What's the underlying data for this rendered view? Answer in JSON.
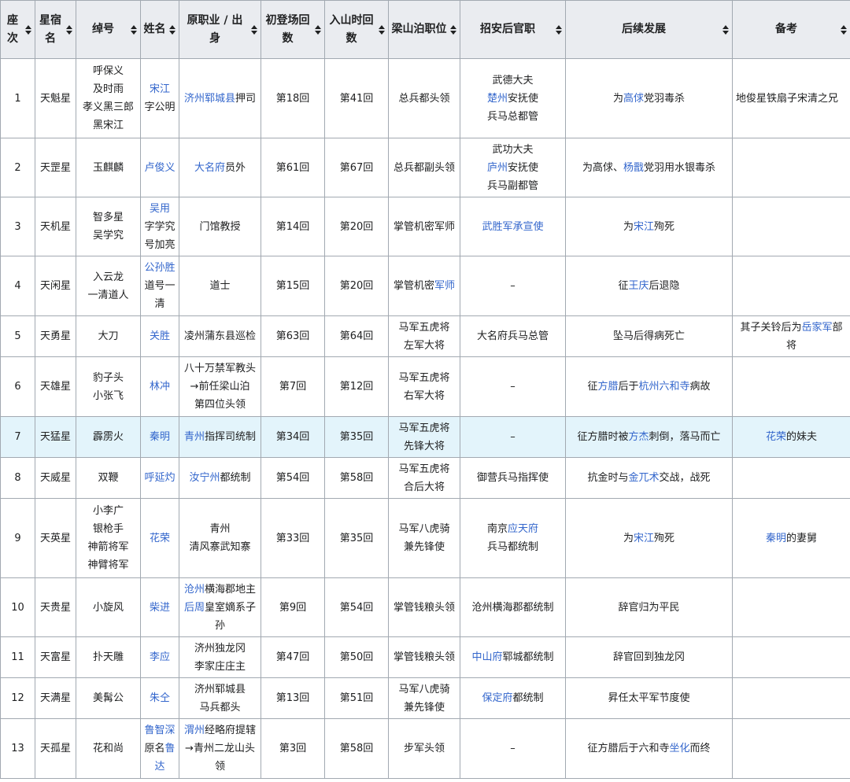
{
  "headers": [
    "座次",
    "星宿名",
    "绰号",
    "姓名",
    "原职业 / 出身",
    "初登场回数",
    "入山时回数",
    "梁山泊职位",
    "招安后官职",
    "后续发展",
    "备考"
  ],
  "rows": [
    {
      "rank": "1",
      "star": "天魁星",
      "nick": [
        [
          {
            "t": "呼保义"
          }
        ],
        [
          {
            "t": "及时雨"
          }
        ],
        [
          {
            "t": "孝义黑三郎"
          }
        ],
        [
          {
            "t": "黑宋江"
          }
        ]
      ],
      "name": [
        [
          {
            "t": "宋江",
            "l": true
          }
        ],
        [
          {
            "t": "字公明"
          }
        ]
      ],
      "origin": [
        [
          {
            "t": "济州",
            "l": true
          },
          {
            "t": "郓城县",
            "l": true
          },
          {
            "t": "押司"
          }
        ]
      ],
      "debut": "第18回",
      "join": "第41回",
      "post": [
        [
          {
            "t": "总兵都头领"
          }
        ]
      ],
      "office": [
        [
          {
            "t": "武德大夫"
          }
        ],
        [
          {
            "t": "楚州",
            "l": true
          },
          {
            "t": "安抚使"
          }
        ],
        [
          {
            "t": "兵马总都管"
          }
        ]
      ],
      "fate": [
        [
          {
            "t": "为"
          },
          {
            "t": "高俅",
            "l": true
          },
          {
            "t": "党羽毒杀"
          }
        ]
      ],
      "note": [
        [
          {
            "t": "地俊星铁扇子宋清之兄"
          }
        ]
      ]
    },
    {
      "rank": "2",
      "star": "天罡星",
      "nick": [
        [
          {
            "t": "玉麒麟"
          }
        ]
      ],
      "name": [
        [
          {
            "t": "卢俊义",
            "l": true
          }
        ]
      ],
      "origin": [
        [
          {
            "t": "大名府",
            "l": true
          },
          {
            "t": "员外"
          }
        ]
      ],
      "debut": "第61回",
      "join": "第67回",
      "post": [
        [
          {
            "t": "总兵都副头领"
          }
        ]
      ],
      "office": [
        [
          {
            "t": "武功大夫"
          }
        ],
        [
          {
            "t": "庐州",
            "l": true
          },
          {
            "t": "安抚使"
          }
        ],
        [
          {
            "t": "兵马副都管"
          }
        ]
      ],
      "fate": [
        [
          {
            "t": "为高俅、"
          },
          {
            "t": "杨戬",
            "l": true
          },
          {
            "t": "党羽用水银毒杀"
          }
        ]
      ],
      "note": []
    },
    {
      "rank": "3",
      "star": "天机星",
      "nick": [
        [
          {
            "t": "智多星"
          }
        ],
        [
          {
            "t": "吴学究"
          }
        ]
      ],
      "name": [
        [
          {
            "t": "吴用",
            "l": true
          }
        ],
        [
          {
            "t": "字学究"
          }
        ],
        [
          {
            "t": "号加亮"
          }
        ]
      ],
      "origin": [
        [
          {
            "t": "门馆教授"
          }
        ]
      ],
      "debut": "第14回",
      "join": "第20回",
      "post": [
        [
          {
            "t": "掌管机密军师"
          }
        ]
      ],
      "office": [
        [
          {
            "t": "武胜军承宣使",
            "l": true
          }
        ]
      ],
      "fate": [
        [
          {
            "t": "为"
          },
          {
            "t": "宋江",
            "l": true
          },
          {
            "t": "殉死"
          }
        ]
      ],
      "note": []
    },
    {
      "rank": "4",
      "star": "天闲星",
      "nick": [
        [
          {
            "t": "入云龙"
          }
        ],
        [
          {
            "t": "一清道人"
          }
        ]
      ],
      "name": [
        [
          {
            "t": "公孙胜",
            "l": true
          }
        ],
        [
          {
            "t": "道号一"
          }
        ],
        [
          {
            "t": "清"
          }
        ]
      ],
      "origin": [
        [
          {
            "t": "道士"
          }
        ]
      ],
      "debut": "第15回",
      "join": "第20回",
      "post": [
        [
          {
            "t": "掌管机密"
          },
          {
            "t": "军师",
            "l": true
          }
        ]
      ],
      "office": [
        [
          {
            "t": "–"
          }
        ]
      ],
      "fate": [
        [
          {
            "t": "征"
          },
          {
            "t": "王庆",
            "l": true
          },
          {
            "t": "后退隐"
          }
        ]
      ],
      "note": []
    },
    {
      "rank": "5",
      "star": "天勇星",
      "nick": [
        [
          {
            "t": "大刀"
          }
        ]
      ],
      "name": [
        [
          {
            "t": "关胜",
            "l": true
          }
        ]
      ],
      "origin": [
        [
          {
            "t": "凌州蒲东县巡检"
          }
        ]
      ],
      "debut": "第63回",
      "join": "第64回",
      "post": [
        [
          {
            "t": "马军五虎将"
          }
        ],
        [
          {
            "t": "左军大将"
          }
        ]
      ],
      "office": [
        [
          {
            "t": "大名府兵马总管"
          }
        ]
      ],
      "fate": [
        [
          {
            "t": "坠马后得病死亡"
          }
        ]
      ],
      "note": [
        [
          {
            "t": "其子关铃后为"
          },
          {
            "t": "岳家军",
            "l": true
          },
          {
            "t": "部"
          }
        ],
        [
          {
            "t": "将"
          }
        ]
      ]
    },
    {
      "rank": "6",
      "star": "天雄星",
      "nick": [
        [
          {
            "t": "豹子头"
          }
        ],
        [
          {
            "t": "小张飞"
          }
        ]
      ],
      "name": [
        [
          {
            "t": "林冲",
            "l": true
          }
        ]
      ],
      "origin": [
        [
          {
            "t": "八十万禁军教头"
          }
        ],
        [
          {
            "t": "→前任梁山泊"
          }
        ],
        [
          {
            "t": "第四位头领"
          }
        ]
      ],
      "debut": "第7回",
      "join": "第12回",
      "post": [
        [
          {
            "t": "马军五虎将"
          }
        ],
        [
          {
            "t": "右军大将"
          }
        ]
      ],
      "office": [
        [
          {
            "t": "–"
          }
        ]
      ],
      "fate": [
        [
          {
            "t": "征"
          },
          {
            "t": "方腊",
            "l": true
          },
          {
            "t": "后于"
          },
          {
            "t": "杭州六和寺",
            "l": true
          },
          {
            "t": "病故"
          }
        ]
      ],
      "note": []
    },
    {
      "rank": "7",
      "star": "天猛星",
      "hl": true,
      "nick": [
        [
          {
            "t": "霹雳火"
          }
        ]
      ],
      "name": [
        [
          {
            "t": "秦明",
            "l": true
          }
        ]
      ],
      "origin": [
        [
          {
            "t": "青州",
            "l": true
          },
          {
            "t": "指挥司统制"
          }
        ]
      ],
      "debut": "第34回",
      "join": "第35回",
      "post": [
        [
          {
            "t": "马军五虎将"
          }
        ],
        [
          {
            "t": "先锋大将"
          }
        ]
      ],
      "office": [
        [
          {
            "t": "–"
          }
        ]
      ],
      "fate": [
        [
          {
            "t": "征方腊时被"
          },
          {
            "t": "方杰",
            "l": true
          },
          {
            "t": "刺倒，落马而亡"
          }
        ]
      ],
      "note": [
        [
          {
            "t": "花荣",
            "l": true
          },
          {
            "t": "的妹夫"
          }
        ]
      ]
    },
    {
      "rank": "8",
      "star": "天威星",
      "nick": [
        [
          {
            "t": "双鞭"
          }
        ]
      ],
      "name": [
        [
          {
            "t": "呼延灼",
            "l": true
          }
        ]
      ],
      "origin": [
        [
          {
            "t": "汝宁州",
            "l": true
          },
          {
            "t": "都统制"
          }
        ]
      ],
      "debut": "第54回",
      "join": "第58回",
      "post": [
        [
          {
            "t": "马军五虎将"
          }
        ],
        [
          {
            "t": "合后大将"
          }
        ]
      ],
      "office": [
        [
          {
            "t": "御营兵马指挥使"
          }
        ]
      ],
      "fate": [
        [
          {
            "t": "抗金时与"
          },
          {
            "t": "金兀术",
            "l": true
          },
          {
            "t": "交战，战死"
          }
        ]
      ],
      "note": []
    },
    {
      "rank": "9",
      "star": "天英星",
      "nick": [
        [
          {
            "t": "小李广"
          }
        ],
        [
          {
            "t": "银枪手"
          }
        ],
        [
          {
            "t": "神箭将军"
          }
        ],
        [
          {
            "t": "神臂将军"
          }
        ]
      ],
      "name": [
        [
          {
            "t": "花荣",
            "l": true
          }
        ]
      ],
      "origin": [
        [
          {
            "t": "青州"
          }
        ],
        [
          {
            "t": "清风寨武知寨"
          }
        ]
      ],
      "debut": "第33回",
      "join": "第35回",
      "post": [
        [
          {
            "t": "马军八虎骑"
          }
        ],
        [
          {
            "t": "兼先锋使"
          }
        ]
      ],
      "office": [
        [
          {
            "t": "南京"
          },
          {
            "t": "应天府",
            "l": true
          }
        ],
        [
          {
            "t": "兵马都统制"
          }
        ]
      ],
      "fate": [
        [
          {
            "t": "为"
          },
          {
            "t": "宋江",
            "l": true
          },
          {
            "t": "殉死"
          }
        ]
      ],
      "note": [
        [
          {
            "t": "秦明",
            "l": true
          },
          {
            "t": "的妻舅"
          }
        ]
      ]
    },
    {
      "rank": "10",
      "star": "天贵星",
      "nick": [
        [
          {
            "t": "小旋风"
          }
        ]
      ],
      "name": [
        [
          {
            "t": "柴进",
            "l": true
          }
        ]
      ],
      "origin": [
        [
          {
            "t": "沧州",
            "l": true
          },
          {
            "t": "横海郡地主"
          }
        ],
        [
          {
            "t": "后周",
            "l": true
          },
          {
            "t": "皇室嫡系子"
          }
        ],
        [
          {
            "t": "孙"
          }
        ]
      ],
      "debut": "第9回",
      "join": "第54回",
      "post": [
        [
          {
            "t": "掌管钱粮头领"
          }
        ]
      ],
      "office": [
        [
          {
            "t": "沧州横海郡都统制"
          }
        ]
      ],
      "fate": [
        [
          {
            "t": "辞官归为平民"
          }
        ]
      ],
      "note": []
    },
    {
      "rank": "11",
      "star": "天富星",
      "nick": [
        [
          {
            "t": "扑天雕"
          }
        ]
      ],
      "name": [
        [
          {
            "t": "李应",
            "l": true
          }
        ]
      ],
      "origin": [
        [
          {
            "t": "济州独龙冈"
          }
        ],
        [
          {
            "t": "李家庄庄主"
          }
        ]
      ],
      "debut": "第47回",
      "join": "第50回",
      "post": [
        [
          {
            "t": "掌管钱粮头领"
          }
        ]
      ],
      "office": [
        [
          {
            "t": "中山府",
            "l": true
          },
          {
            "t": "郓城都统制"
          }
        ]
      ],
      "fate": [
        [
          {
            "t": "辞官回到独龙冈"
          }
        ]
      ],
      "note": []
    },
    {
      "rank": "12",
      "star": "天满星",
      "nick": [
        [
          {
            "t": "美髯公"
          }
        ]
      ],
      "name": [
        [
          {
            "t": "朱仝",
            "l": true
          }
        ]
      ],
      "origin": [
        [
          {
            "t": "济州郓城县"
          }
        ],
        [
          {
            "t": "马兵都头"
          }
        ]
      ],
      "debut": "第13回",
      "join": "第51回",
      "post": [
        [
          {
            "t": "马军八虎骑"
          }
        ],
        [
          {
            "t": "兼先锋使"
          }
        ]
      ],
      "office": [
        [
          {
            "t": "保定府",
            "l": true
          },
          {
            "t": "都统制"
          }
        ]
      ],
      "fate": [
        [
          {
            "t": "昇任太平军节度使"
          }
        ]
      ],
      "note": []
    },
    {
      "rank": "13",
      "star": "天孤星",
      "nick": [
        [
          {
            "t": "花和尚"
          }
        ]
      ],
      "name": [
        [
          {
            "t": "鲁智深",
            "l": true
          }
        ],
        [
          {
            "t": "原名"
          },
          {
            "t": "鲁",
            "l": true
          }
        ],
        [
          {
            "t": "达",
            "l": true
          }
        ]
      ],
      "origin": [
        [
          {
            "t": "渭州",
            "l": true
          },
          {
            "t": "经略府提辖"
          }
        ],
        [
          {
            "t": "→青州二龙山头"
          }
        ],
        [
          {
            "t": "领"
          }
        ]
      ],
      "debut": "第3回",
      "join": "第58回",
      "post": [
        [
          {
            "t": "步军头领"
          }
        ]
      ],
      "office": [
        [
          {
            "t": "–"
          }
        ]
      ],
      "fate": [
        [
          {
            "t": "征方腊后于六和寺"
          },
          {
            "t": "坐化",
            "l": true
          },
          {
            "t": "而终"
          }
        ]
      ],
      "note": []
    }
  ]
}
